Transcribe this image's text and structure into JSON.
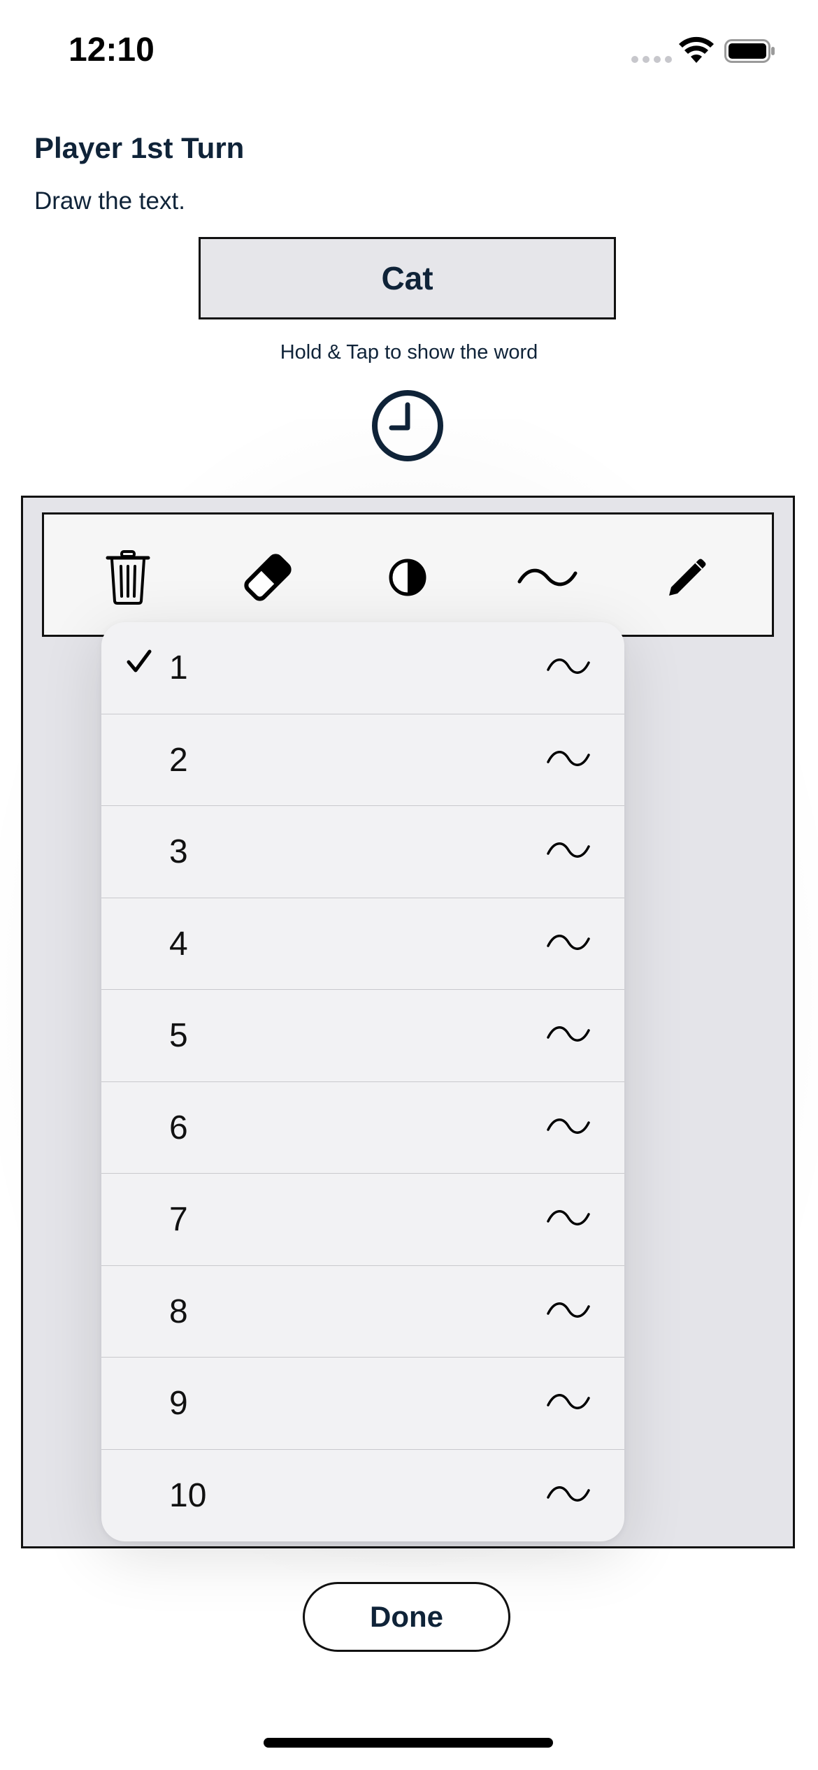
{
  "status_bar": {
    "time": "12:10",
    "icons": [
      "signal-icon",
      "wifi-icon",
      "battery-icon"
    ]
  },
  "header": {
    "turn_title": "Player 1st Turn",
    "instruction": "Draw the text.",
    "word": "Cat",
    "hint": "Hold & Tap to show the word",
    "timer_icon": "clock-icon"
  },
  "toolbar": {
    "tools": [
      "trash-icon",
      "eraser-icon",
      "contrast-icon",
      "squiggle-icon",
      "pencil-icon"
    ]
  },
  "stroke_menu": {
    "selected": "1",
    "items": [
      {
        "label": "1",
        "checked": true
      },
      {
        "label": "2",
        "checked": false
      },
      {
        "label": "3",
        "checked": false
      },
      {
        "label": "4",
        "checked": false
      },
      {
        "label": "5",
        "checked": false
      },
      {
        "label": "6",
        "checked": false
      },
      {
        "label": "7",
        "checked": false
      },
      {
        "label": "8",
        "checked": false
      },
      {
        "label": "9",
        "checked": false
      },
      {
        "label": "10",
        "checked": false
      }
    ]
  },
  "footer": {
    "done_label": "Done"
  },
  "colors": {
    "text": "#0f2338",
    "canvas": "#e4e4e9",
    "menu_bg": "#f2f2f4"
  }
}
